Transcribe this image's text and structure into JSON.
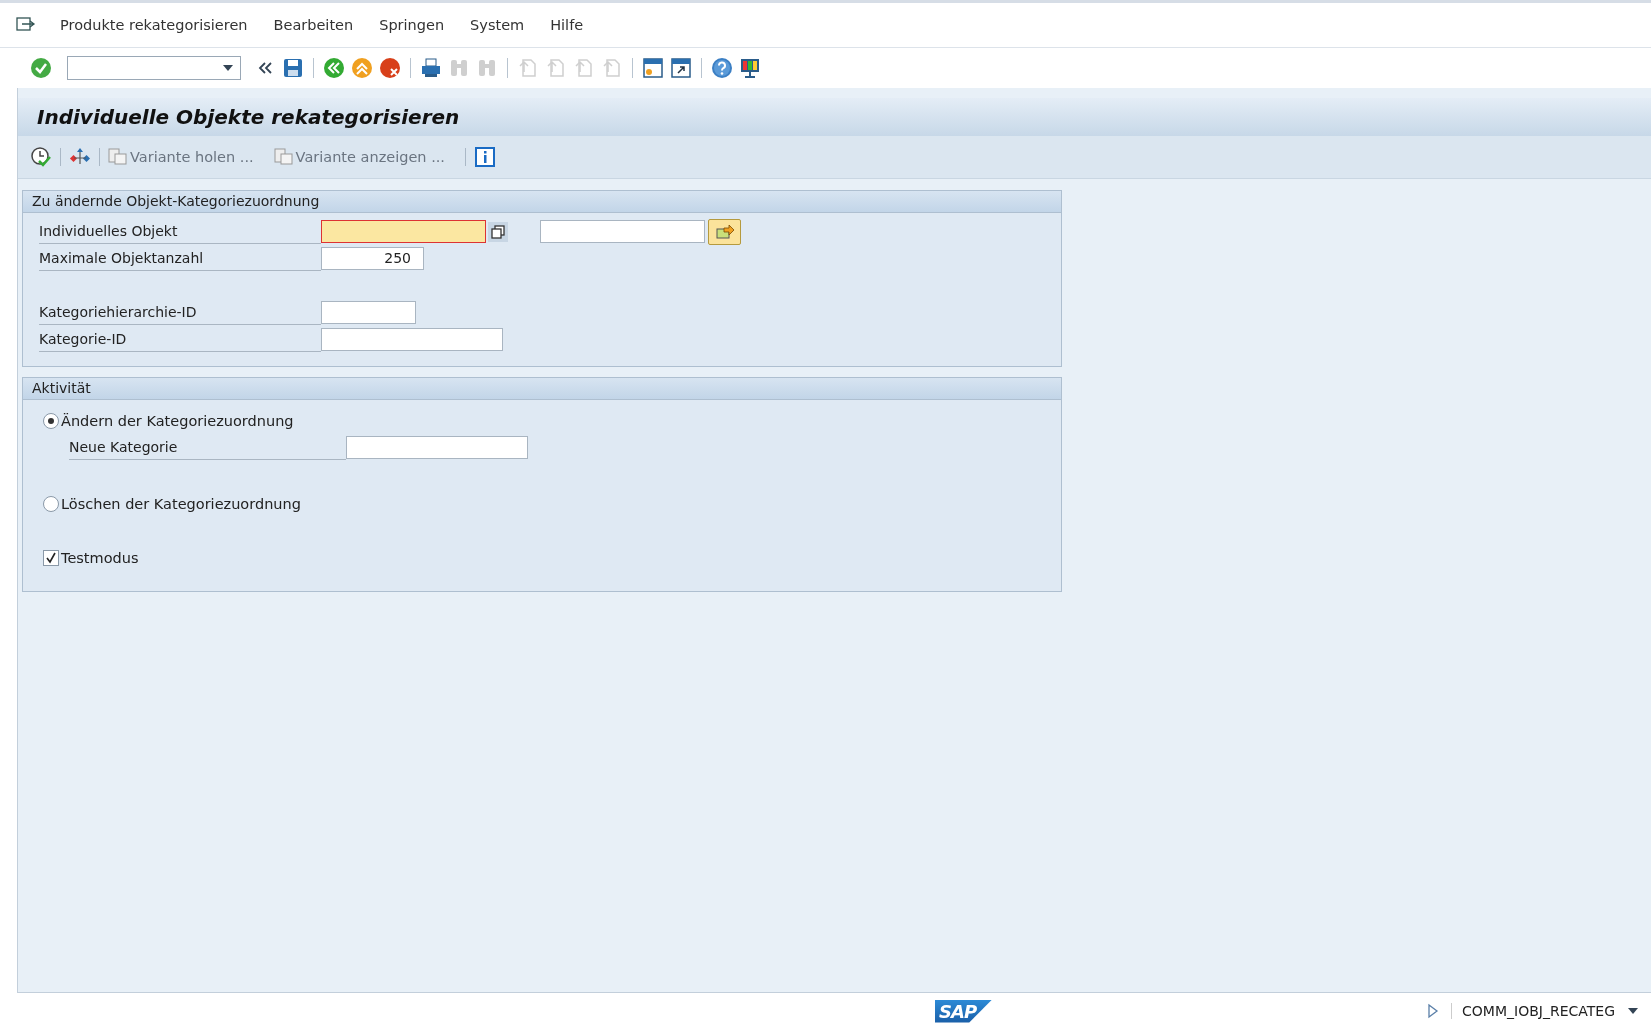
{
  "menu": [
    "Produkte rekategorisieren",
    "Bearbeiten",
    "Springen",
    "System",
    "Hilfe"
  ],
  "toolbar": [
    {
      "kind": "enter",
      "disabled": false
    },
    {
      "kind": "command-field"
    },
    {
      "kind": "collapse",
      "disabled": false
    },
    {
      "kind": "save",
      "disabled": false
    },
    {
      "kind": "separator"
    },
    {
      "kind": "back",
      "disabled": false
    },
    {
      "kind": "exit",
      "disabled": false
    },
    {
      "kind": "cancel",
      "disabled": false
    },
    {
      "kind": "separator"
    },
    {
      "kind": "print",
      "disabled": false
    },
    {
      "kind": "find",
      "disabled": true
    },
    {
      "kind": "find-next",
      "disabled": true
    },
    {
      "kind": "separator"
    },
    {
      "kind": "first-page",
      "disabled": true
    },
    {
      "kind": "prev-page",
      "disabled": true
    },
    {
      "kind": "next-page",
      "disabled": true
    },
    {
      "kind": "last-page",
      "disabled": true
    },
    {
      "kind": "separator"
    },
    {
      "kind": "new-session",
      "disabled": false
    },
    {
      "kind": "shortcut",
      "disabled": false
    },
    {
      "kind": "separator"
    },
    {
      "kind": "help",
      "disabled": false
    },
    {
      "kind": "layout",
      "disabled": false
    }
  ],
  "title": "Individuelle Objekte rekategorisieren",
  "app_toolbar": [
    {
      "kind": "execute",
      "disabled": false
    },
    {
      "kind": "separator"
    },
    {
      "kind": "hierarchy",
      "disabled": false
    },
    {
      "kind": "separator"
    },
    {
      "kind": "variant",
      "label": "Variante holen ...",
      "disabled": true
    },
    {
      "kind": "variant",
      "label": "Variante anzeigen ...",
      "disabled": true
    },
    {
      "kind": "separator"
    },
    {
      "kind": "info",
      "disabled": false
    }
  ],
  "selection": {
    "title": "Zu ändernde Objekt-Kategoriezuordnung",
    "rows": [
      {
        "kind": "range",
        "label": "Individuelles Objekt",
        "focused": true
      },
      {
        "kind": "number",
        "label": "Maximale Objektanzahl",
        "value": "250"
      },
      {
        "kind": "gap"
      },
      {
        "kind": "short",
        "label": "Kategoriehierarchie-ID"
      },
      {
        "kind": "medium",
        "label": "Kategorie-ID"
      }
    ]
  },
  "activity": {
    "title": "Aktivität",
    "options": [
      {
        "label": "Ändern der Kategoriezuordnung",
        "selected": true,
        "field_label": "Neue Kategorie"
      },
      {
        "label": "Löschen der Kategoriezuordnung",
        "selected": false
      }
    ],
    "test_mode": {
      "label": "Testmodus",
      "checked": true
    }
  },
  "status_bar": {
    "logo": "SAP",
    "transaction": "COMM_IOBJ_RECATEG"
  }
}
